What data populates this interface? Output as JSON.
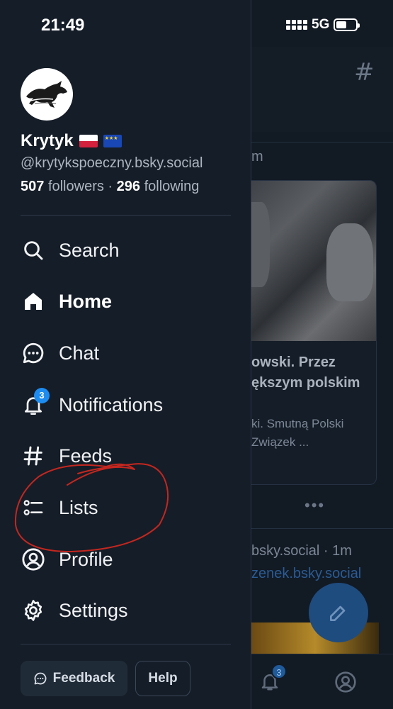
{
  "status_bar": {
    "time": "21:49",
    "network": "5G"
  },
  "profile": {
    "display_name": "Krytyk",
    "flags": [
      "poland-flag",
      "eu-flag"
    ],
    "handle": "@krytykspoeczny.bsky.social",
    "followers_count": "507",
    "followers_label": "followers",
    "separator": "·",
    "following_count": "296",
    "following_label": "following"
  },
  "nav": {
    "items": [
      {
        "label": "Search",
        "icon": "search-icon"
      },
      {
        "label": "Home",
        "icon": "home-icon",
        "active": true
      },
      {
        "label": "Chat",
        "icon": "chat-icon"
      },
      {
        "label": "Notifications",
        "icon": "bell-icon",
        "badge": "3"
      },
      {
        "label": "Feeds",
        "icon": "hash-icon"
      },
      {
        "label": "Lists",
        "icon": "list-icon"
      },
      {
        "label": "Profile",
        "icon": "user-circle-icon"
      },
      {
        "label": "Settings",
        "icon": "gear-icon"
      }
    ]
  },
  "footer": {
    "feedback_label": "Feedback",
    "help_label": "Help"
  },
  "background_feed": {
    "header_icon": "hash-icon",
    "timestamp_fragment": "m",
    "post_title": "owski. Przez ększym polskim",
    "post_desc": "ki. Smutną Polski Związek ...",
    "handle_fragment": "bsky.social · 1m",
    "link_fragment": "zenek.bsky.social",
    "tab_badge": "3"
  },
  "colors": {
    "drawer_bg": "#151d28",
    "accent_blue": "#1d8cf0",
    "annotation_red": "#c4271f"
  }
}
